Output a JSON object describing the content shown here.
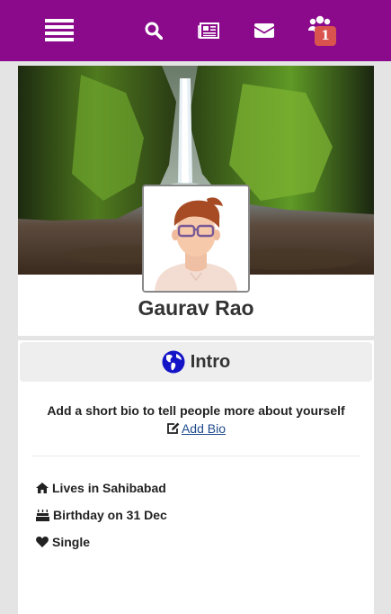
{
  "navbar": {
    "badge_count": "1",
    "icons": [
      "menu-icon",
      "search-icon",
      "newspaper-icon",
      "envelope-icon",
      "friends-icon"
    ],
    "background": "#8b0a8b"
  },
  "profile": {
    "name": "Gaurav Rao"
  },
  "intro": {
    "title": "Intro",
    "bio_prompt": "Add a short bio to tell people more about yourself",
    "add_bio_label": " Add Bio",
    "items": [
      {
        "icon": "home-icon",
        "text": "Lives in Sahibabad"
      },
      {
        "icon": "birthday-cake-icon",
        "text": "Birthday on 31 Dec"
      },
      {
        "icon": "heart-icon",
        "text": "Single"
      }
    ]
  },
  "colors": {
    "accent": "#8b0a8b",
    "badge": "#d9534f",
    "link": "#1e4a8c",
    "globe": "#1515c8"
  }
}
